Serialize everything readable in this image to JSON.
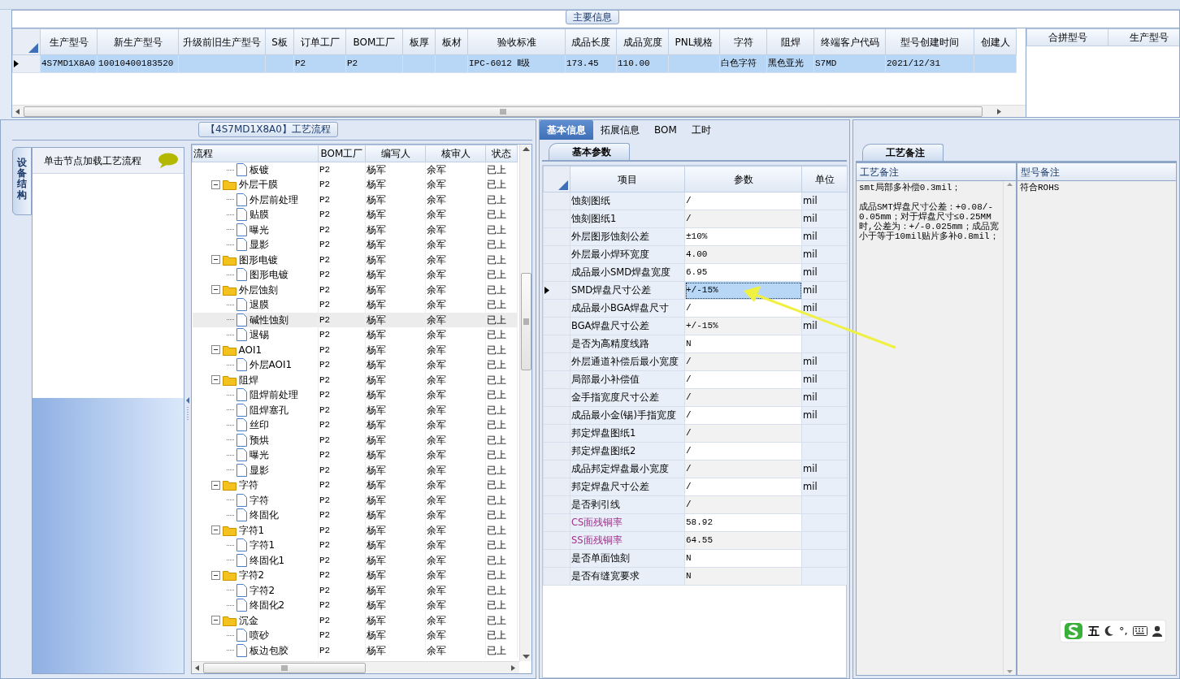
{
  "main_info": {
    "title": "主要信息",
    "grid": {
      "columns": [
        "生产型号",
        "新生产型号",
        "升级前旧生产型号",
        "S板",
        "订单工厂",
        "BOM工厂",
        "板厚",
        "板材",
        "验收标准",
        "成品长度",
        "成品宽度",
        "PNL规格",
        "字符",
        "阻焊",
        "终端客户代码",
        "型号创建时间",
        "创建人"
      ],
      "rows": [
        {
          "selected": true,
          "cells": [
            "4S7MD1X8A0",
            "10010400183520",
            "",
            "",
            "P2",
            "P2",
            "",
            "",
            "IPC-6012 Ⅱ级",
            "173.45",
            "110.00",
            "",
            "白色字符",
            "黑色亚光",
            "S7MD",
            "2021/12/31",
            ""
          ]
        }
      ]
    },
    "side_grid": {
      "columns": [
        "合拼型号",
        "生产型号"
      ]
    }
  },
  "process": {
    "title": "【4S7MD1X8A0】工艺流程",
    "side_tab": "设备结构",
    "hint": "单击节点加载工艺流程",
    "tree": {
      "columns": [
        "流程",
        "BOM工厂",
        "编写人",
        "核审人",
        "状态"
      ],
      "orphan_rows": [
        {
          "kind": "file",
          "label": "板镀",
          "bom": "P2",
          "writer": "杨军",
          "reviewer": "余军",
          "status": "已上",
          "selected": false
        }
      ],
      "nodes": [
        {
          "kind": "folder",
          "label": "外层干膜",
          "bom": "P2",
          "writer": "杨军",
          "reviewer": "余军",
          "status": "已上",
          "selected": false,
          "expanded": true,
          "children": [
            {
              "kind": "file",
              "label": "外层前处理",
              "bom": "P2",
              "writer": "杨军",
              "reviewer": "余军",
              "status": "已上",
              "selected": false
            },
            {
              "kind": "file",
              "label": "贴膜",
              "bom": "P2",
              "writer": "杨军",
              "reviewer": "余军",
              "status": "已上",
              "selected": false
            },
            {
              "kind": "file",
              "label": "曝光",
              "bom": "P2",
              "writer": "杨军",
              "reviewer": "余军",
              "status": "已上",
              "selected": false
            },
            {
              "kind": "file",
              "label": "显影",
              "bom": "P2",
              "writer": "杨军",
              "reviewer": "余军",
              "status": "已上",
              "selected": false
            }
          ]
        },
        {
          "kind": "folder",
          "label": "图形电镀",
          "bom": "P2",
          "writer": "杨军",
          "reviewer": "余军",
          "status": "已上",
          "selected": false,
          "expanded": true,
          "children": [
            {
              "kind": "file",
              "label": "图形电镀",
              "bom": "P2",
              "writer": "杨军",
              "reviewer": "余军",
              "status": "已上",
              "selected": false
            }
          ]
        },
        {
          "kind": "folder",
          "label": "外层蚀刻",
          "bom": "P2",
          "writer": "杨军",
          "reviewer": "余军",
          "status": "已上",
          "selected": false,
          "expanded": true,
          "children": [
            {
              "kind": "file",
              "label": "退膜",
              "bom": "P2",
              "writer": "杨军",
              "reviewer": "余军",
              "status": "已上",
              "selected": false
            },
            {
              "kind": "file",
              "label": "碱性蚀刻",
              "bom": "P2",
              "writer": "杨军",
              "reviewer": "余军",
              "status": "已上",
              "selected": true
            },
            {
              "kind": "file",
              "label": "退锡",
              "bom": "P2",
              "writer": "杨军",
              "reviewer": "余军",
              "status": "已上",
              "selected": false
            }
          ]
        },
        {
          "kind": "folder",
          "label": "AOI1",
          "bom": "P2",
          "writer": "杨军",
          "reviewer": "余军",
          "status": "已上",
          "selected": false,
          "expanded": true,
          "children": [
            {
              "kind": "file",
              "label": "外层AOI1",
              "bom": "P2",
              "writer": "杨军",
              "reviewer": "余军",
              "status": "已上",
              "selected": false
            }
          ]
        },
        {
          "kind": "folder",
          "label": "阻焊",
          "bom": "P2",
          "writer": "杨军",
          "reviewer": "余军",
          "status": "已上",
          "selected": false,
          "expanded": true,
          "children": [
            {
              "kind": "file",
              "label": "阻焊前处理",
              "bom": "P2",
              "writer": "杨军",
              "reviewer": "余军",
              "status": "已上",
              "selected": false
            },
            {
              "kind": "file",
              "label": "阻焊塞孔",
              "bom": "P2",
              "writer": "杨军",
              "reviewer": "余军",
              "status": "已上",
              "selected": false
            },
            {
              "kind": "file",
              "label": "丝印",
              "bom": "P2",
              "writer": "杨军",
              "reviewer": "余军",
              "status": "已上",
              "selected": false
            },
            {
              "kind": "file",
              "label": "预烘",
              "bom": "P2",
              "writer": "杨军",
              "reviewer": "余军",
              "status": "已上",
              "selected": false
            },
            {
              "kind": "file",
              "label": "曝光",
              "bom": "P2",
              "writer": "杨军",
              "reviewer": "余军",
              "status": "已上",
              "selected": false
            },
            {
              "kind": "file",
              "label": "显影",
              "bom": "P2",
              "writer": "杨军",
              "reviewer": "余军",
              "status": "已上",
              "selected": false
            }
          ]
        },
        {
          "kind": "folder",
          "label": "字符",
          "bom": "P2",
          "writer": "杨军",
          "reviewer": "余军",
          "status": "已上",
          "selected": false,
          "expanded": true,
          "children": [
            {
              "kind": "file",
              "label": "字符",
              "bom": "P2",
              "writer": "杨军",
              "reviewer": "余军",
              "status": "已上",
              "selected": false
            },
            {
              "kind": "file",
              "label": "终固化",
              "bom": "P2",
              "writer": "杨军",
              "reviewer": "余军",
              "status": "已上",
              "selected": false
            }
          ]
        },
        {
          "kind": "folder",
          "label": "字符1",
          "bom": "P2",
          "writer": "杨军",
          "reviewer": "余军",
          "status": "已上",
          "selected": false,
          "expanded": true,
          "children": [
            {
              "kind": "file",
              "label": "字符1",
              "bom": "P2",
              "writer": "杨军",
              "reviewer": "余军",
              "status": "已上",
              "selected": false
            },
            {
              "kind": "file",
              "label": "终固化1",
              "bom": "P2",
              "writer": "杨军",
              "reviewer": "余军",
              "status": "已上",
              "selected": false
            }
          ]
        },
        {
          "kind": "folder",
          "label": "字符2",
          "bom": "P2",
          "writer": "杨军",
          "reviewer": "余军",
          "status": "已上",
          "selected": false,
          "expanded": true,
          "children": [
            {
              "kind": "file",
              "label": "字符2",
              "bom": "P2",
              "writer": "杨军",
              "reviewer": "余军",
              "status": "已上",
              "selected": false
            },
            {
              "kind": "file",
              "label": "终固化2",
              "bom": "P2",
              "writer": "杨军",
              "reviewer": "余军",
              "status": "已上",
              "selected": false
            }
          ]
        },
        {
          "kind": "folder",
          "label": "沉金",
          "bom": "P2",
          "writer": "杨军",
          "reviewer": "余军",
          "status": "已上",
          "selected": false,
          "expanded": true,
          "children": [
            {
              "kind": "file",
              "label": "喷砂",
              "bom": "P2",
              "writer": "杨军",
              "reviewer": "余军",
              "status": "已上",
              "selected": false
            },
            {
              "kind": "file",
              "label": "板边包胶",
              "bom": "P2",
              "writer": "杨军",
              "reviewer": "余军",
              "status": "已上",
              "selected": false
            }
          ]
        }
      ]
    }
  },
  "detail": {
    "tabs": [
      {
        "label": "基本信息",
        "selected": true
      },
      {
        "label": "拓展信息",
        "selected": false
      },
      {
        "label": "BOM",
        "selected": false
      },
      {
        "label": "工时",
        "selected": false
      }
    ],
    "subtab": "基本参数",
    "columns": [
      "项目",
      "参数",
      "单位"
    ],
    "params": [
      {
        "item": "蚀刻图纸",
        "value": "/",
        "unit": "mil",
        "selected": false,
        "flagged": false
      },
      {
        "item": "蚀刻图纸1",
        "value": "/",
        "unit": "mil",
        "selected": false,
        "flagged": false
      },
      {
        "item": "外层图形蚀刻公差",
        "value": "±10%",
        "unit": "mil",
        "selected": false,
        "flagged": false
      },
      {
        "item": "外层最小焊环宽度",
        "value": "4.00",
        "unit": "mil",
        "selected": false,
        "flagged": false
      },
      {
        "item": "成品最小SMD焊盘宽度",
        "value": "6.95",
        "unit": "mil",
        "selected": false,
        "flagged": false
      },
      {
        "item": "SMD焊盘尺寸公差",
        "value": "+/-15%",
        "unit": "mil",
        "selected": true,
        "flagged": false
      },
      {
        "item": "成品最小BGA焊盘尺寸",
        "value": "/",
        "unit": "mil",
        "selected": false,
        "flagged": false
      },
      {
        "item": "BGA焊盘尺寸公差",
        "value": "+/-15%",
        "unit": "mil",
        "selected": false,
        "flagged": false
      },
      {
        "item": "是否为高精度线路",
        "value": "N",
        "selected": false,
        "flagged": false
      },
      {
        "item": "外层通道补偿后最小宽度",
        "value": "/",
        "unit": "mil",
        "selected": false,
        "flagged": false
      },
      {
        "item": "局部最小补偿值",
        "value": "/",
        "unit": "mil",
        "selected": false,
        "flagged": false
      },
      {
        "item": "金手指宽度尺寸公差",
        "value": "/",
        "unit": "mil",
        "selected": false,
        "flagged": false
      },
      {
        "item": "成品最小金(锡)手指宽度",
        "value": "/",
        "unit": "mil",
        "selected": false,
        "flagged": false
      },
      {
        "item": "邦定焊盘图纸1",
        "value": "/",
        "selected": false,
        "flagged": false
      },
      {
        "item": "邦定焊盘图纸2",
        "value": "/",
        "selected": false,
        "flagged": false
      },
      {
        "item": "成品邦定焊盘最小宽度",
        "value": "/",
        "unit": "mil",
        "selected": false,
        "flagged": false
      },
      {
        "item": "邦定焊盘尺寸公差",
        "value": "/",
        "unit": "mil",
        "selected": false,
        "flagged": false
      },
      {
        "item": "是否剥引线",
        "value": "/",
        "selected": false,
        "flagged": false
      },
      {
        "item": "CS面残铜率",
        "value": "58.92",
        "selected": false,
        "flagged": true
      },
      {
        "item": "SS面残铜率",
        "value": "64.55",
        "selected": false,
        "flagged": true
      },
      {
        "item": "是否单面蚀刻",
        "value": "N",
        "selected": false,
        "flagged": false
      },
      {
        "item": "是否有缝宽要求",
        "value": "N",
        "selected": false,
        "flagged": false
      }
    ]
  },
  "notes": {
    "tab": "工艺备注",
    "columns": [
      "工艺备注",
      "型号备注"
    ],
    "process_note": [
      "smt局部多补偿0.3mil；",
      "成品SMT焊盘尺寸公差：+0.08/-0.05mm；对于焊盘尺寸≤0.25MM时,公差为：+/-0.025mm；成品宽小于等于10mil贴片多补0.8mil；"
    ],
    "model_note": "符合ROHS"
  },
  "ime_toolbar": {
    "mode": "五",
    "punct": "°,"
  }
}
